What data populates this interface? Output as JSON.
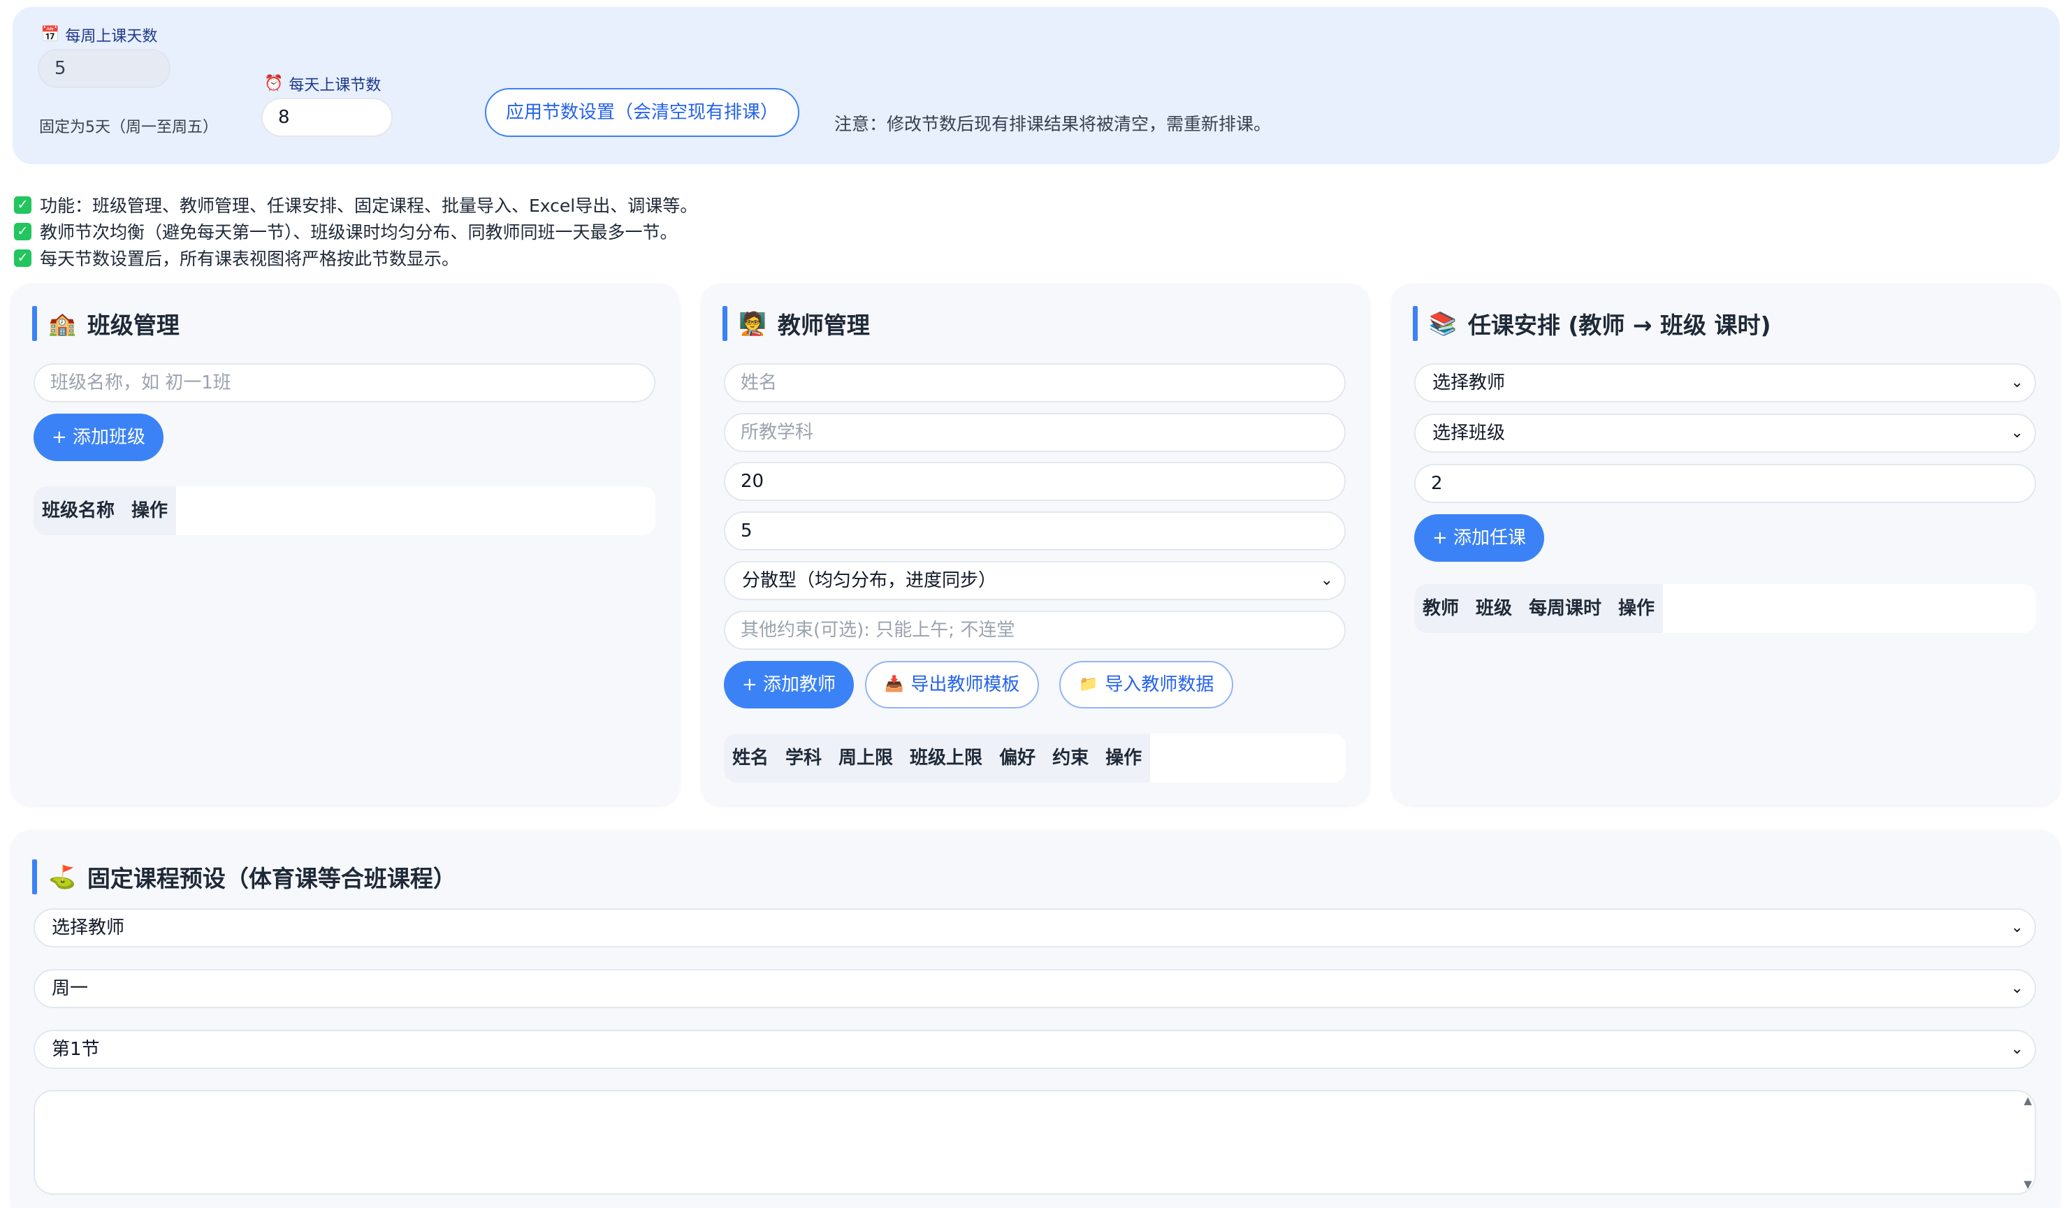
{
  "settings": {
    "days_label": "每周上课天数",
    "days_value": "5",
    "days_note": "固定为5天（周一至周五）",
    "periods_label": "每天上课节数",
    "periods_value": "8",
    "apply_button": "应用节数设置（会清空现有排课）",
    "warning": "注意：修改节数后现有排课结果将被清空，需重新排课。"
  },
  "notes": [
    "功能：班级管理、教师管理、任课安排、固定课程、批量导入、Excel导出、调课等。",
    "教师节次均衡（避免每天第一节）、班级课时均匀分布、同教师同班一天最多一节。",
    "每天节数设置后，所有课表视图将严格按此节数显示。"
  ],
  "class_card": {
    "title": "班级管理",
    "name_placeholder": "班级名称，如 初一1班",
    "add_button": "+ 添加班级",
    "columns": [
      "班级名称",
      "操作"
    ]
  },
  "teacher_card": {
    "title": "教师管理",
    "name_placeholder": "姓名",
    "subject_placeholder": "所教学科",
    "weekly_limit": "20",
    "class_limit": "5",
    "preference": "分散型（均匀分布，进度同步）",
    "constraint_placeholder": "其他约束(可选): 只能上午; 不连堂",
    "add_button": "+ 添加教师",
    "export_button": "导出教师模板",
    "import_button": "导入教师数据",
    "columns": [
      "姓名",
      "学科",
      "周上限",
      "班级上限",
      "偏好",
      "约束",
      "操作"
    ]
  },
  "assign_card": {
    "title": "任课安排 (教师 → 班级 课时)",
    "teacher_select": "选择教师",
    "class_select": "选择班级",
    "hours_value": "2",
    "add_button": "+ 添加任课",
    "columns": [
      "教师",
      "班级",
      "每周课时",
      "操作"
    ]
  },
  "fixed_card": {
    "title": "固定课程预设（体育课等合班课程）",
    "teacher_select": "选择教师",
    "day_select": "周一",
    "period_select": "第1节",
    "textarea_value": ""
  },
  "colors": {
    "accent": "#3b82f6",
    "panel_bg": "#e8effd",
    "card_bg": "#f6f8fc",
    "check_green": "#22c55e"
  },
  "icons": {
    "days": "calendar-icon",
    "periods": "alarm-clock-icon",
    "class": "school-icon",
    "teacher": "teacher-icon",
    "assign": "books-icon",
    "fixed": "golf-flag-icon",
    "export": "inbox-tray-icon",
    "import": "folder-icon",
    "note": "check-icon"
  }
}
